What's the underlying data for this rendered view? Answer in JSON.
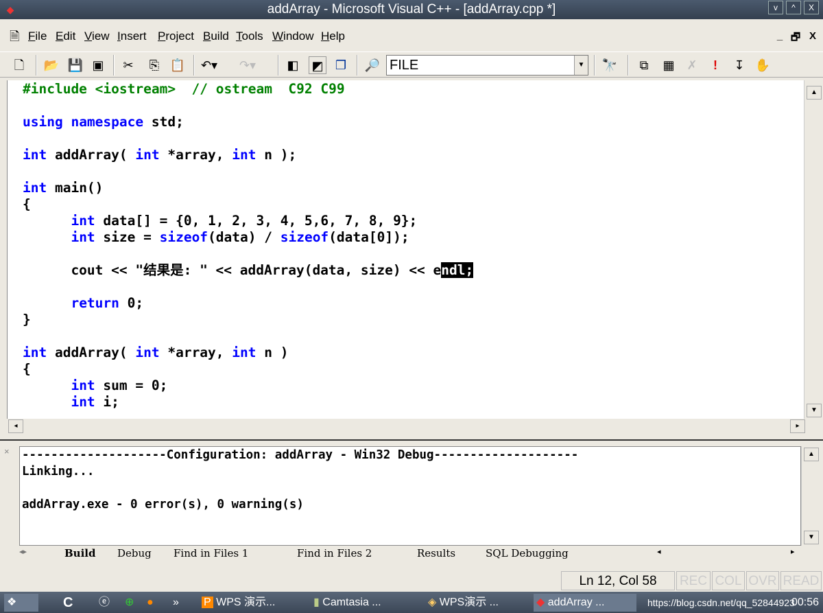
{
  "window": {
    "title": "addArray - Microsoft Visual C++ - [addArray.cpp *]",
    "min": "v",
    "max": "^",
    "close": "X"
  },
  "menu": [
    "File",
    "Edit",
    "View",
    "Insert",
    "Project",
    "Build",
    "Tools",
    "Window",
    "Help"
  ],
  "mdi": {
    "min": "_",
    "restore": "🗗",
    "close": "X"
  },
  "toolbar": {
    "combo_value": "FILE",
    "icons": [
      "new-text-file-icon",
      "open-icon",
      "save-icon",
      "save-all-icon",
      "cut-icon",
      "copy-icon",
      "paste-icon",
      "undo-icon",
      "redo-icon",
      "workspace-icon",
      "output-icon",
      "window-list-icon",
      "find-in-files-icon",
      "find-icon",
      "compile-icon",
      "build-icon",
      "stop-build-icon",
      "execute-icon",
      "go-icon",
      "breakpoint-icon"
    ]
  },
  "code": [
    [
      [
        "cm",
        "#include <iostream>  // ostream  C92 C99"
      ]
    ],
    [],
    [
      [
        "kw",
        "using"
      ],
      [
        "",
        ""
      ],
      [
        "",
        " "
      ],
      [
        "kw",
        "namespace"
      ],
      [
        "",
        " std;"
      ]
    ],
    [],
    [
      [
        "kw",
        "int"
      ],
      [
        "",
        " addArray( "
      ],
      [
        "kw",
        "int"
      ],
      [
        "",
        " *array, "
      ],
      [
        "kw",
        "int"
      ],
      [
        "",
        " n );"
      ]
    ],
    [],
    [
      [
        "kw",
        "int"
      ],
      [
        "",
        " main()"
      ]
    ],
    [
      [
        "",
        "{"
      ]
    ],
    [
      [
        "",
        "      "
      ],
      [
        "kw",
        "int"
      ],
      [
        "",
        " data[] = {0, 1, 2, 3, 4, 5,6, 7, 8, 9};"
      ]
    ],
    [
      [
        "",
        "      "
      ],
      [
        "kw",
        "int"
      ],
      [
        "",
        " size = "
      ],
      [
        "kw",
        "sizeof"
      ],
      [
        "",
        "(data) / "
      ],
      [
        "kw",
        "sizeof"
      ],
      [
        "",
        "(data[0]);"
      ]
    ],
    [],
    [
      [
        "",
        "      cout << \"结果是: \" << addArray(data, size) << e"
      ],
      [
        "sel",
        "ndl;"
      ]
    ],
    [],
    [
      [
        "",
        "      "
      ],
      [
        "kw",
        "return"
      ],
      [
        "",
        " 0;"
      ]
    ],
    [
      [
        "",
        "}"
      ]
    ],
    [],
    [
      [
        "kw",
        "int"
      ],
      [
        "",
        " addArray( "
      ],
      [
        "kw",
        "int"
      ],
      [
        "",
        " *array, "
      ],
      [
        "kw",
        "int"
      ],
      [
        "",
        " n )"
      ]
    ],
    [
      [
        "",
        "{"
      ]
    ],
    [
      [
        "",
        "      "
      ],
      [
        "kw",
        "int"
      ],
      [
        "",
        " sum = 0;"
      ]
    ],
    [
      [
        "",
        "      "
      ],
      [
        "kw",
        "int"
      ],
      [
        "",
        " i;"
      ]
    ]
  ],
  "output": [
    "--------------------Configuration: addArray - Win32 Debug--------------------",
    "Linking...",
    "",
    "addArray.exe - 0 error(s), 0 warning(s)"
  ],
  "output_tabs": [
    "Build",
    "Debug",
    "Find in Files 1",
    "Find in Files 2",
    "Results",
    "SQL Debugging"
  ],
  "status": {
    "position": "Ln 12, Col 58",
    "rec": "REC",
    "col": "COL",
    "ovr": "OVR",
    "read": "READ"
  },
  "taskbar": {
    "items": [
      "WPS 演示...",
      "Camtasia ...",
      "WPS演示 ...",
      "addArray ..."
    ],
    "tray_text": "https://blog.csdn.net/qq_52844923",
    "clock": "00:56"
  },
  "colors": {
    "keyword": "#0000ff",
    "comment": "#008000"
  }
}
